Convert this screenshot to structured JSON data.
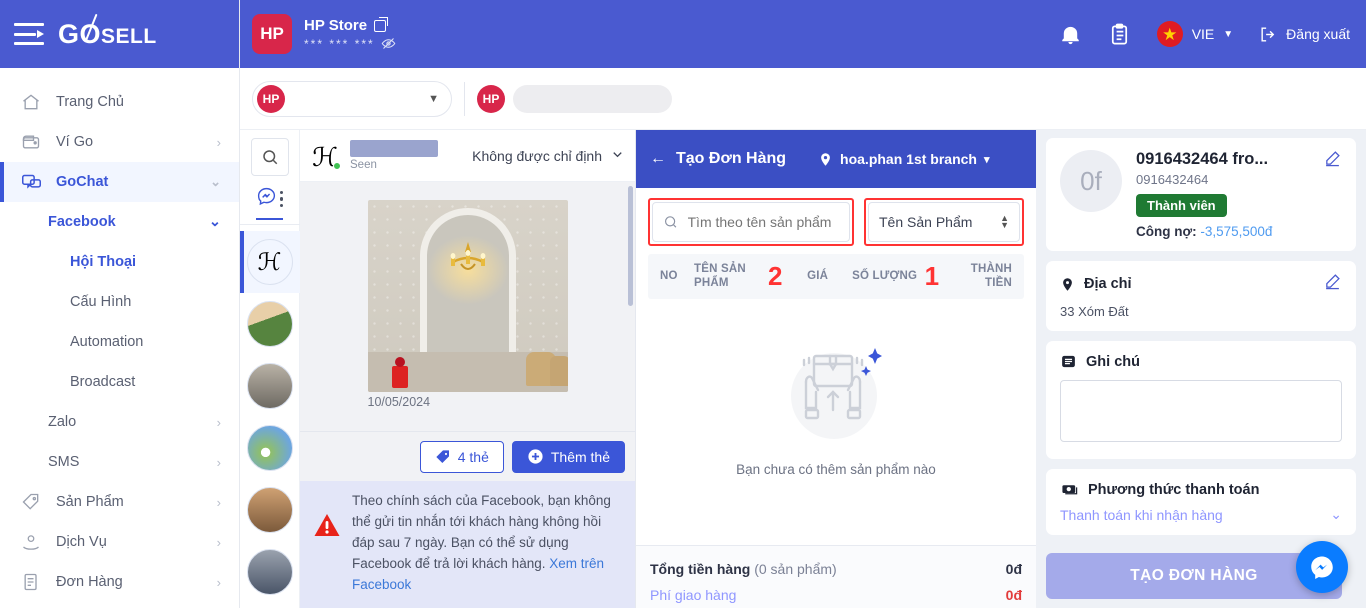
{
  "brand": {
    "name": "GoSELL",
    "menu_icon": "hamburger-icon"
  },
  "sidebar": {
    "items": [
      {
        "label": "Trang Chủ",
        "icon": "home-icon",
        "chevron": ""
      },
      {
        "label": "Ví Go",
        "icon": "wallet-icon",
        "chevron": "›"
      },
      {
        "label": "GoChat",
        "icon": "chat-icon",
        "chevron": "⌄",
        "active": true
      }
    ],
    "sub_facebook": {
      "label": "Facebook",
      "chevron": "⌄"
    },
    "facebook_children": [
      "Hội Thoại",
      "Cấu Hình",
      "Automation",
      "Broadcast"
    ],
    "items_after": [
      {
        "label": "Zalo",
        "chevron": "›"
      },
      {
        "label": "SMS",
        "chevron": "›"
      }
    ],
    "items_bottom": [
      {
        "label": "Sản Phẩm",
        "icon": "tag-icon",
        "chevron": "›"
      },
      {
        "label": "Dịch Vụ",
        "icon": "service-icon",
        "chevron": "›"
      },
      {
        "label": "Đơn Hàng",
        "icon": "order-icon",
        "chevron": "›"
      }
    ]
  },
  "topbar": {
    "store_name": "HP Store",
    "store_initials": "HP",
    "masked_id": "***  ***  ***",
    "external_icon": "external-link-icon",
    "eye_icon": "eye-off-icon",
    "bell_icon": "bell-icon",
    "clipboard_icon": "clipboard-icon",
    "lang_code": "VIE",
    "logout_label": "Đăng xuất",
    "logout_icon": "logout-icon"
  },
  "filterbar": {
    "page_select_value": "",
    "page_select_icon": "store-avatar-icon",
    "search_placeholder": ""
  },
  "chat": {
    "rail": {
      "search_icon": "search-icon",
      "inbox_icon": "messenger-inbox-icon",
      "more_icon": "more-vertical-icon"
    },
    "header": {
      "avatar_glyph": "ℋ",
      "status": "Seen",
      "assign_label": "Không được chỉ định",
      "chevron": "⌄"
    },
    "message_date": "10/05/2024",
    "tags_button": "4 thẻ",
    "tags_icon": "tag-icon",
    "add_tag_button": "Thêm thẻ",
    "add_tag_icon": "plus-circle-icon",
    "warning_icon": "warning-triangle-icon",
    "warning_text": "Theo chính sách của Facebook, bạn không thể gửi tin nhắn tới khách hàng không hồi đáp sau 7 ngày. Bạn có thể sử dụng Facebook để trả lời khách hàng. ",
    "warning_link": "Xem trên Facebook"
  },
  "order": {
    "back_icon": "arrow-left-icon",
    "title": "Tạo Đơn Hàng",
    "branch_icon": "location-pin-icon",
    "branch": "hoa.phan 1st branch",
    "branch_chevron": "▾",
    "search_icon": "search-icon",
    "search_placeholder": "Tìm theo tên sản phẩm",
    "sort_value": "Tên Sản Phẩm",
    "table_headers": {
      "no": "NO",
      "name": "TÊN SẢN PHẨM",
      "price": "GIÁ",
      "qty": "SỐ LƯỢNG",
      "total": "THÀNH TIỀN"
    },
    "markers": {
      "name_marker": "2",
      "qty_marker": "1"
    },
    "empty_icon": "empty-box-hands-icon",
    "empty_text": "Bạn chưa có thêm sản phẩm nào",
    "totals": [
      {
        "label": "Tổng tiền hàng",
        "sub": "(0 sản phẩm)",
        "value": "0đ"
      },
      {
        "label": "Phí giao hàng",
        "sub": "",
        "value": "0đ"
      }
    ]
  },
  "customer": {
    "avatar_text": "0f",
    "name": "0916432464 fro...",
    "phone": "0916432464",
    "badge": "Thành viên",
    "debt_label": "Công nợ:",
    "debt_value": "-3,575,500đ",
    "edit_icon": "pencil-icon",
    "address": {
      "icon": "location-pin-icon",
      "title": "Địa chỉ",
      "value": "33 Xóm Đất",
      "edit_icon": "pencil-icon"
    },
    "note": {
      "icon": "note-icon",
      "title": "Ghi chú",
      "value": ""
    },
    "payment": {
      "icon": "cash-icon",
      "title": "Phương thức thanh toán",
      "value": "Thanh toán khi nhận hàng",
      "chevron": "⌄"
    }
  },
  "overlay": {
    "create_order_button": "TẠO ĐƠN HÀNG",
    "messenger_icon": "messenger-icon"
  },
  "colors": {
    "brand_blue": "#4a5ad0",
    "accent_blue": "#3b56d8",
    "red": "#d8264a",
    "highlight_red": "#ff3333",
    "green": "#1f7a33"
  }
}
